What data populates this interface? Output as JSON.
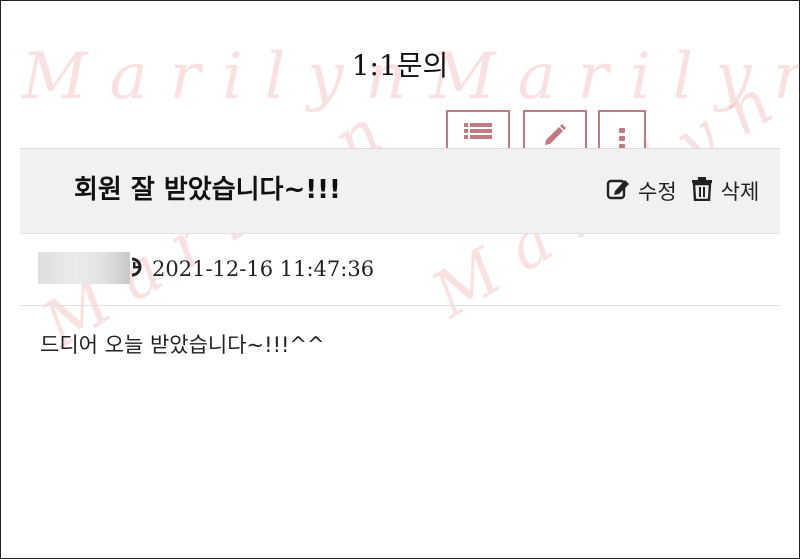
{
  "page": {
    "title": "1:1문의",
    "watermark_text": "Marilyn"
  },
  "toolbar": {
    "buttons": [
      {
        "name": "list",
        "icon": "list-icon"
      },
      {
        "name": "write",
        "icon": "pencil-icon"
      },
      {
        "name": "more",
        "icon": "vertical-ellipsis-icon"
      }
    ]
  },
  "post": {
    "title": "회원 잘 받았습니다~!!!",
    "edit_label": "수정",
    "delete_label": "삭제",
    "datetime": "2021-12-16 11:47:36",
    "body": "드디어 오늘 받았습니다~!!!^^"
  },
  "colors": {
    "accent": "#c27a82",
    "watermark": "#e87878",
    "header_background": "#f1f1f1"
  }
}
